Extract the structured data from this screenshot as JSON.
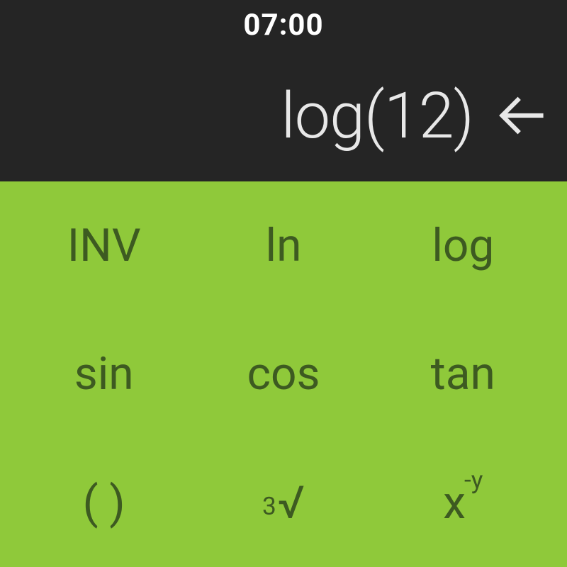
{
  "status": {
    "time": "07:00"
  },
  "display": {
    "expression": "log(12)"
  },
  "keypad": {
    "rows": [
      [
        {
          "id": "inv",
          "label": "INV"
        },
        {
          "id": "ln",
          "label": "ln"
        },
        {
          "id": "log",
          "label": "log"
        }
      ],
      [
        {
          "id": "sin",
          "label": "sin"
        },
        {
          "id": "cos",
          "label": "cos"
        },
        {
          "id": "tan",
          "label": "tan"
        }
      ],
      [
        {
          "id": "paren",
          "label": "( )"
        },
        {
          "id": "cuberoot",
          "pre_sup": "3",
          "main": "√"
        },
        {
          "id": "xpowy",
          "main": "x",
          "sup": "-y"
        }
      ]
    ]
  },
  "colors": {
    "display_bg": "#252525",
    "display_fg": "#e8e8e8",
    "keypad_bg": "#8fc93a",
    "keypad_fg": "#3d5a21"
  }
}
